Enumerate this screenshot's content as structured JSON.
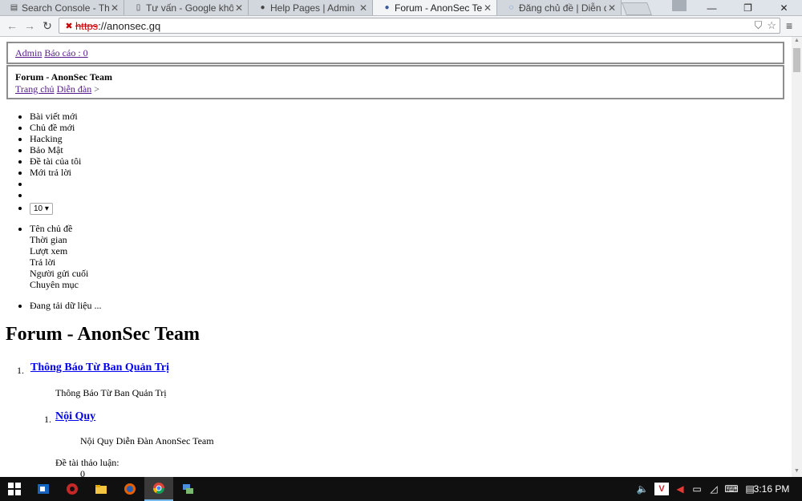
{
  "browser": {
    "tabs": [
      {
        "label": "Search Console - Th",
        "icon": "search-console-icon"
      },
      {
        "label": "Tư vấn - Google khô",
        "icon": "document-icon"
      },
      {
        "label": "Help Pages | Admin",
        "icon": "globe-icon"
      },
      {
        "label": "Forum - AnonSec Te",
        "icon": "globe-icon",
        "active": true
      },
      {
        "label": "Đăng chủ đề | Diễn đ",
        "icon": "loading-icon"
      }
    ],
    "url_scheme": "https",
    "url_rest": "://anonsec.gq"
  },
  "page": {
    "topbar": {
      "admin": "Admin",
      "report": "Báo cáo : 0"
    },
    "header": {
      "title": "Forum - AnonSec Team",
      "crumb_home": "Trang chủ",
      "crumb_forum": "Diễn đàn",
      "crumb_sep": ">"
    },
    "nav_items": [
      "Bài viết mới",
      "Chủ đề mới",
      "Hacking",
      "Bảo Mật",
      "Đề tài của tôi",
      "Mới trả lời"
    ],
    "per_page": "10 ▾",
    "columns": [
      "Tên chủ đề",
      "Thời gian",
      "Lượt xem",
      "Trả lời",
      "Người gửi cuối",
      "Chuyên mục"
    ],
    "loading": "Đang tải dữ liệu ...",
    "forum_title": "Forum - AnonSec Team",
    "categories": [
      {
        "num": "1.",
        "title": "Thông Báo Từ Ban Quản Trị",
        "desc": "Thông Báo Từ Ban Quản Trị"
      }
    ],
    "subforum": {
      "num": "1.",
      "title": "Nội Quy",
      "desc": "Nội Quy Diễn Đàn AnonSec Team",
      "topics_label": "Đề tài thảo luận:",
      "topics_value": "0"
    }
  },
  "taskbar": {
    "time": "3:16 PM"
  },
  "colors": {
    "link": "#0000ee",
    "visited": "#551a8b",
    "taskbar": "#101010"
  }
}
